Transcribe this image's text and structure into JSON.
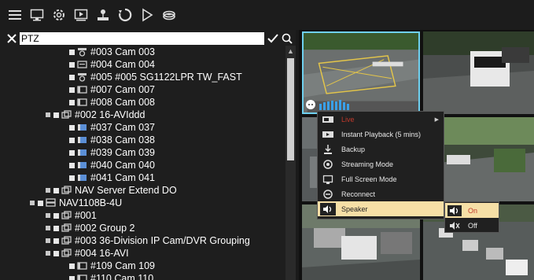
{
  "toolbar": {
    "buttons": [
      "menu-icon",
      "monitor-icon",
      "gear-icon",
      "playback-icon",
      "network-icon",
      "refresh-icon",
      "play-icon",
      "database-icon"
    ]
  },
  "search": {
    "value": "PTZ"
  },
  "tree": [
    {
      "label": "#003 Cam 003"
    },
    {
      "label": "#004 Cam 004"
    },
    {
      "label": "#005 #005 SG1122LPR TW_FAST"
    },
    {
      "label": "#007 Cam 007"
    },
    {
      "label": "#008 Cam 008"
    },
    {
      "label": "#002 16-AVIddd"
    },
    {
      "label": "#037 Cam 037"
    },
    {
      "label": "#038 Cam 038"
    },
    {
      "label": "#039 Cam 039"
    },
    {
      "label": "#040 Cam 040"
    },
    {
      "label": "#041 Cam 041"
    },
    {
      "label": "NAV Server Extend DO"
    },
    {
      "label": "NAV1108B-4U"
    },
    {
      "label": "#001"
    },
    {
      "label": "#002 Group 2"
    },
    {
      "label": "#003 36-Division IP Cam/DVR Grouping"
    },
    {
      "label": "#004 16-AVI"
    },
    {
      "label": "#109 Cam 109"
    },
    {
      "label": "#110 Cam 110"
    }
  ],
  "context_menu": {
    "items": [
      {
        "label": "Live",
        "color": "#c0392b"
      },
      {
        "label": "Instant Playback (5 mins)"
      },
      {
        "label": "Backup"
      },
      {
        "label": "Streaming Mode"
      },
      {
        "label": "Full Screen Mode"
      },
      {
        "label": "Reconnect"
      },
      {
        "label": "Speaker"
      }
    ],
    "submenu": [
      {
        "label": "On"
      },
      {
        "label": "Off"
      }
    ]
  },
  "colors": {
    "selection": "#6fd1f0",
    "highlight": "#f6dfa6",
    "live_red": "#c0392b"
  }
}
